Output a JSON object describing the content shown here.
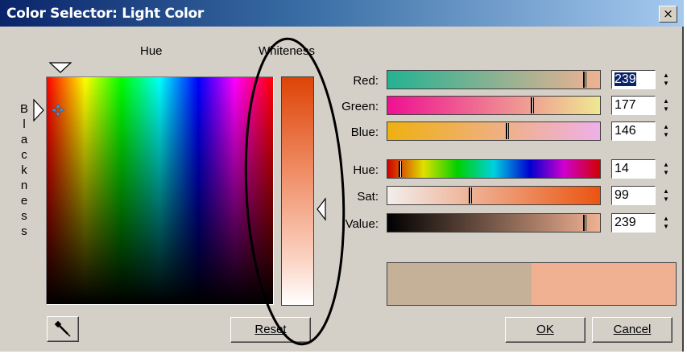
{
  "window": {
    "title": "Color Selector: Light Color",
    "close_label": "×"
  },
  "labels": {
    "hue": "Hue",
    "whiteness": "Whiteness",
    "blackness_letters": [
      "B",
      "l",
      "a",
      "c",
      "k",
      "n",
      "e",
      "s",
      "s"
    ]
  },
  "sliders": [
    {
      "label": "Red:",
      "value": "239",
      "fraction": 0.94,
      "selected": true
    },
    {
      "label": "Green:",
      "value": "177",
      "fraction": 0.69
    },
    {
      "label": "Blue:",
      "value": "146",
      "fraction": 0.57
    },
    {
      "label": "Hue:",
      "value": "14",
      "fraction": 0.055
    },
    {
      "label": "Sat:",
      "value": "99",
      "fraction": 0.39
    },
    {
      "label": "Value:",
      "value": "239",
      "fraction": 0.94
    }
  ],
  "preview": {
    "old_color": "#c4b197",
    "new_color": "#efb192"
  },
  "buttons": {
    "reset": "Reset",
    "ok": "OK",
    "cancel": "Cancel"
  },
  "colors": {
    "current": "#efb192",
    "whiteness_top": "#dd4406",
    "annotation_ellipse": "#000000"
  },
  "icons": {
    "eyedropper": "eyedropper-icon",
    "spinner": "spinner-arrows-icon"
  }
}
